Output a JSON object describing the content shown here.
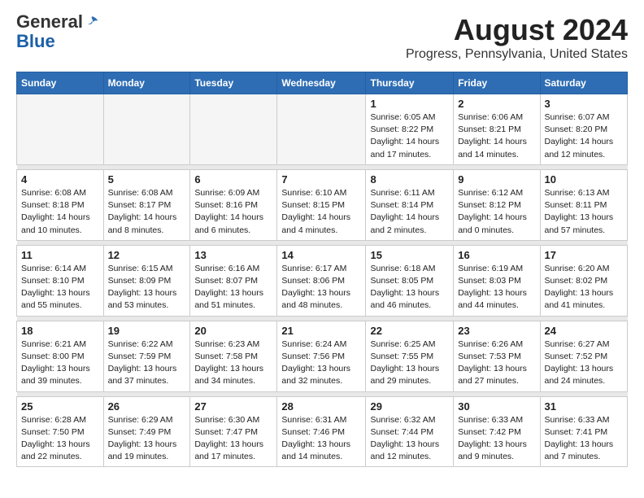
{
  "header": {
    "logo_general": "General",
    "logo_blue": "Blue",
    "month_year": "August 2024",
    "location": "Progress, Pennsylvania, United States"
  },
  "weekdays": [
    "Sunday",
    "Monday",
    "Tuesday",
    "Wednesday",
    "Thursday",
    "Friday",
    "Saturday"
  ],
  "weeks": [
    [
      {
        "day": "",
        "empty": true
      },
      {
        "day": "",
        "empty": true
      },
      {
        "day": "",
        "empty": true
      },
      {
        "day": "",
        "empty": true
      },
      {
        "day": "1",
        "sunrise": "6:05 AM",
        "sunset": "8:22 PM",
        "daylight": "14 hours and 17 minutes."
      },
      {
        "day": "2",
        "sunrise": "6:06 AM",
        "sunset": "8:21 PM",
        "daylight": "14 hours and 14 minutes."
      },
      {
        "day": "3",
        "sunrise": "6:07 AM",
        "sunset": "8:20 PM",
        "daylight": "14 hours and 12 minutes."
      }
    ],
    [
      {
        "day": "4",
        "sunrise": "6:08 AM",
        "sunset": "8:18 PM",
        "daylight": "14 hours and 10 minutes."
      },
      {
        "day": "5",
        "sunrise": "6:08 AM",
        "sunset": "8:17 PM",
        "daylight": "14 hours and 8 minutes."
      },
      {
        "day": "6",
        "sunrise": "6:09 AM",
        "sunset": "8:16 PM",
        "daylight": "14 hours and 6 minutes."
      },
      {
        "day": "7",
        "sunrise": "6:10 AM",
        "sunset": "8:15 PM",
        "daylight": "14 hours and 4 minutes."
      },
      {
        "day": "8",
        "sunrise": "6:11 AM",
        "sunset": "8:14 PM",
        "daylight": "14 hours and 2 minutes."
      },
      {
        "day": "9",
        "sunrise": "6:12 AM",
        "sunset": "8:12 PM",
        "daylight": "14 hours and 0 minutes."
      },
      {
        "day": "10",
        "sunrise": "6:13 AM",
        "sunset": "8:11 PM",
        "daylight": "13 hours and 57 minutes."
      }
    ],
    [
      {
        "day": "11",
        "sunrise": "6:14 AM",
        "sunset": "8:10 PM",
        "daylight": "13 hours and 55 minutes."
      },
      {
        "day": "12",
        "sunrise": "6:15 AM",
        "sunset": "8:09 PM",
        "daylight": "13 hours and 53 minutes."
      },
      {
        "day": "13",
        "sunrise": "6:16 AM",
        "sunset": "8:07 PM",
        "daylight": "13 hours and 51 minutes."
      },
      {
        "day": "14",
        "sunrise": "6:17 AM",
        "sunset": "8:06 PM",
        "daylight": "13 hours and 48 minutes."
      },
      {
        "day": "15",
        "sunrise": "6:18 AM",
        "sunset": "8:05 PM",
        "daylight": "13 hours and 46 minutes."
      },
      {
        "day": "16",
        "sunrise": "6:19 AM",
        "sunset": "8:03 PM",
        "daylight": "13 hours and 44 minutes."
      },
      {
        "day": "17",
        "sunrise": "6:20 AM",
        "sunset": "8:02 PM",
        "daylight": "13 hours and 41 minutes."
      }
    ],
    [
      {
        "day": "18",
        "sunrise": "6:21 AM",
        "sunset": "8:00 PM",
        "daylight": "13 hours and 39 minutes."
      },
      {
        "day": "19",
        "sunrise": "6:22 AM",
        "sunset": "7:59 PM",
        "daylight": "13 hours and 37 minutes."
      },
      {
        "day": "20",
        "sunrise": "6:23 AM",
        "sunset": "7:58 PM",
        "daylight": "13 hours and 34 minutes."
      },
      {
        "day": "21",
        "sunrise": "6:24 AM",
        "sunset": "7:56 PM",
        "daylight": "13 hours and 32 minutes."
      },
      {
        "day": "22",
        "sunrise": "6:25 AM",
        "sunset": "7:55 PM",
        "daylight": "13 hours and 29 minutes."
      },
      {
        "day": "23",
        "sunrise": "6:26 AM",
        "sunset": "7:53 PM",
        "daylight": "13 hours and 27 minutes."
      },
      {
        "day": "24",
        "sunrise": "6:27 AM",
        "sunset": "7:52 PM",
        "daylight": "13 hours and 24 minutes."
      }
    ],
    [
      {
        "day": "25",
        "sunrise": "6:28 AM",
        "sunset": "7:50 PM",
        "daylight": "13 hours and 22 minutes."
      },
      {
        "day": "26",
        "sunrise": "6:29 AM",
        "sunset": "7:49 PM",
        "daylight": "13 hours and 19 minutes."
      },
      {
        "day": "27",
        "sunrise": "6:30 AM",
        "sunset": "7:47 PM",
        "daylight": "13 hours and 17 minutes."
      },
      {
        "day": "28",
        "sunrise": "6:31 AM",
        "sunset": "7:46 PM",
        "daylight": "13 hours and 14 minutes."
      },
      {
        "day": "29",
        "sunrise": "6:32 AM",
        "sunset": "7:44 PM",
        "daylight": "13 hours and 12 minutes."
      },
      {
        "day": "30",
        "sunrise": "6:33 AM",
        "sunset": "7:42 PM",
        "daylight": "13 hours and 9 minutes."
      },
      {
        "day": "31",
        "sunrise": "6:33 AM",
        "sunset": "7:41 PM",
        "daylight": "13 hours and 7 minutes."
      }
    ]
  ]
}
